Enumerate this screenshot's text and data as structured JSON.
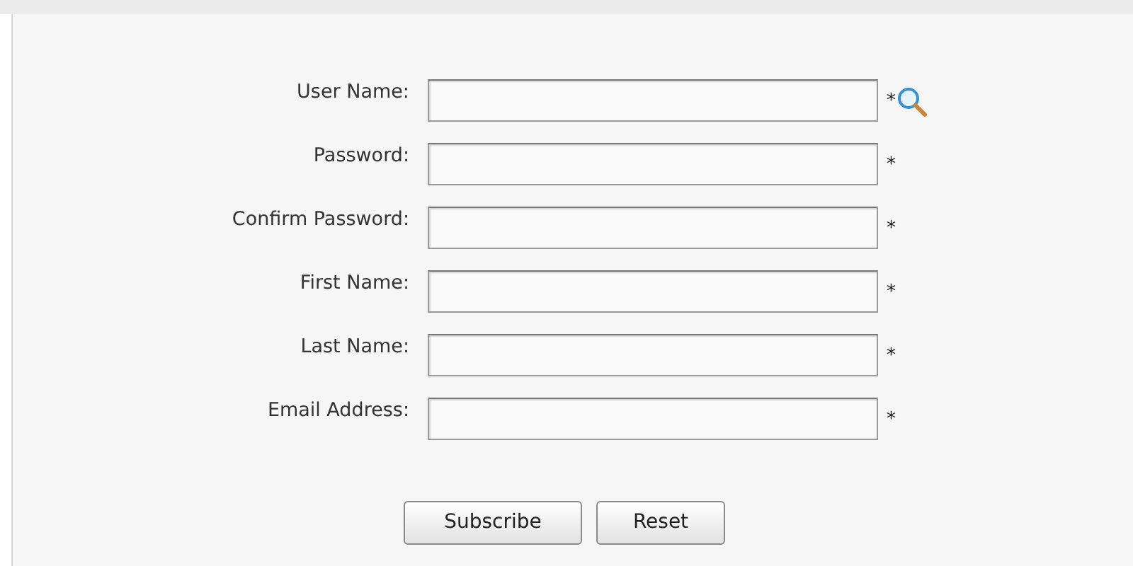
{
  "form": {
    "fields": [
      {
        "label": "User Name:",
        "mark": "*",
        "lookup": true
      },
      {
        "label": "Password:",
        "mark": "*",
        "lookup": false
      },
      {
        "label": "Confirm Password:",
        "mark": "*",
        "lookup": false
      },
      {
        "label": "First Name:",
        "mark": "*",
        "lookup": false
      },
      {
        "label": "Last Name:",
        "mark": "*",
        "lookup": false
      },
      {
        "label": "Email Address:",
        "mark": "*",
        "lookup": false
      }
    ],
    "buttons": [
      "Subscribe",
      "Reset"
    ]
  }
}
